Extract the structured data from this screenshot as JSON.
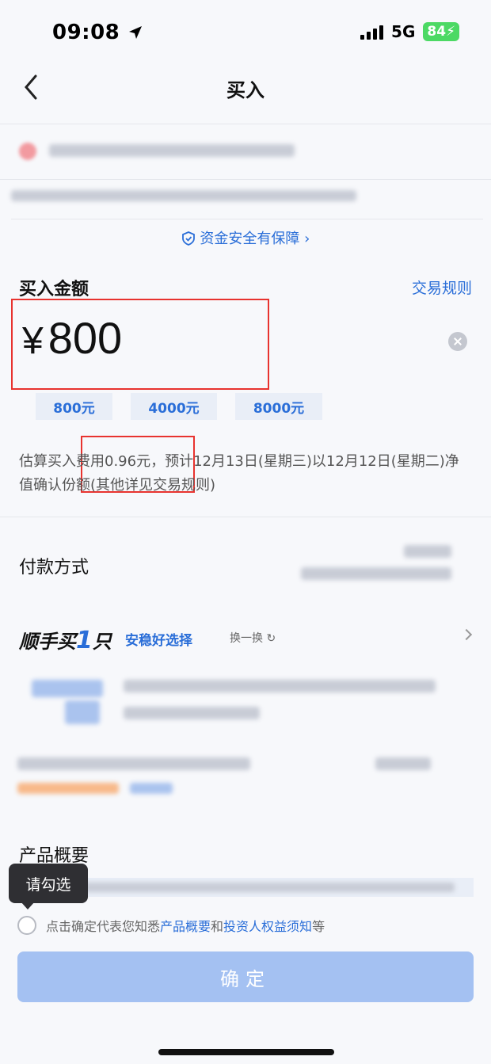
{
  "status_bar": {
    "time": "09:08",
    "network": "5G",
    "battery": "84"
  },
  "nav": {
    "title": "买入"
  },
  "fund": {
    "safety_text": "资金安全有保障 ›"
  },
  "buy": {
    "label": "买入金额",
    "trade_rule": "交易规则",
    "currency": "¥",
    "amount": "800",
    "quick_amounts": [
      "800元",
      "4000元",
      "8000元"
    ],
    "fee_text": "估算买入费用0.96元，预计12月13日(星期三)以12月12日(星期二)净值确认份额(其他详见交易规则)"
  },
  "payment": {
    "label": "付款方式"
  },
  "recommend": {
    "title_prefix": "顺手买",
    "title_num": "1",
    "title_suffix": "只",
    "tag": "安稳好选择",
    "switch": "换一换 ↻"
  },
  "overview": {
    "label": "产品概要"
  },
  "tooltip": {
    "text": "请勾选"
  },
  "agreement": {
    "prefix": "点击确定代表您知悉",
    "link1": "产品概要",
    "middle": "和",
    "link2": "投资人权益须知",
    "suffix": "等"
  },
  "confirm": {
    "label": "确定"
  },
  "colors": {
    "accent": "#2a6ed8",
    "highlight_box": "#e8332f",
    "confirm_bg": "#a4c1f2"
  }
}
